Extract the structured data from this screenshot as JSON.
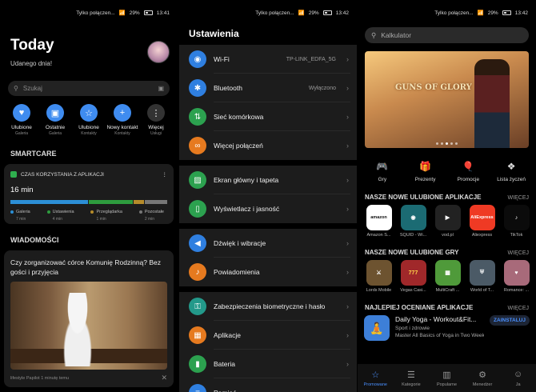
{
  "status": [
    {
      "carrier": "Tylko połączen...",
      "battery": "29%",
      "time": "13:41"
    },
    {
      "carrier": "Tylko połączen...",
      "battery": "29%",
      "time": "13:42"
    },
    {
      "carrier": "Tylko połączen...",
      "battery": "29%",
      "time": "13:42"
    }
  ],
  "today": {
    "title": "Today",
    "greeting": "Udanego dnia!",
    "search_placeholder": "Szukaj",
    "quick_actions": [
      {
        "label": "Ulubione",
        "sub": "Galeria",
        "icon": "heart-icon",
        "color": "#3f8cf0"
      },
      {
        "label": "Ostatnie",
        "sub": "Galeria",
        "icon": "image-icon",
        "color": "#3f8cf0"
      },
      {
        "label": "Ulubione",
        "sub": "Kontakty",
        "icon": "star-icon",
        "color": "#3f8cf0"
      },
      {
        "label": "Nowy kontakt",
        "sub": "Kontakty",
        "icon": "plus-icon",
        "color": "#3f8cf0"
      },
      {
        "label": "Więcej",
        "sub": "Usługi",
        "icon": "more-icon",
        "color": "#333"
      }
    ],
    "smartcare_title": "SMARTCARE",
    "usage_title": "CZAS KORZYSTANIA Z APLIKACJI",
    "usage_total": "16 min",
    "usage": [
      {
        "name": "Galeria",
        "value": "7 min",
        "minutes": 7,
        "color": "#2c8fd6"
      },
      {
        "name": "Ustawienia",
        "value": "4 min",
        "minutes": 4,
        "color": "#2e9c3e"
      },
      {
        "name": "Przeglądarka",
        "value": "1 min",
        "minutes": 1,
        "color": "#b58b2a"
      },
      {
        "name": "Pozostałe",
        "value": "2 min",
        "minutes": 2,
        "color": "#777"
      }
    ],
    "news_title": "WIADOMOŚCI",
    "news_headline": "Czy zorganizować córce Komunię Rodzinną? Bez gości i przyjęcia",
    "news_source": "lifestyle Papilot 1 minutę temu"
  },
  "settings": {
    "title": "Ustawienia",
    "groups": [
      [
        {
          "label": "Wi-Fi",
          "value": "TP-LINK_EDFA_5G",
          "icon": "wifi-icon",
          "color": "#2f7fe0"
        },
        {
          "label": "Bluetooth",
          "value": "Wyłączono",
          "icon": "bluetooth-icon",
          "color": "#2f7fe0"
        },
        {
          "label": "Sieć komórkowa",
          "value": "",
          "icon": "mobile-data-icon",
          "color": "#2ca14f"
        },
        {
          "label": "Więcej połączeń",
          "value": "",
          "icon": "link-icon",
          "color": "#e67a1f"
        }
      ],
      [
        {
          "label": "Ekran główny i tapeta",
          "value": "",
          "icon": "wallpaper-icon",
          "color": "#2ca14f"
        },
        {
          "label": "Wyświetlacz i jasność",
          "value": "",
          "icon": "display-icon",
          "color": "#2ca14f"
        }
      ],
      [
        {
          "label": "Dźwięk i wibracje",
          "value": "",
          "icon": "sound-icon",
          "color": "#2f7fe0"
        },
        {
          "label": "Powiadomienia",
          "value": "",
          "icon": "bell-icon",
          "color": "#e67a1f"
        }
      ],
      [
        {
          "label": "Zabezpieczenia biometryczne i hasło",
          "value": "",
          "icon": "key-icon",
          "color": "#23998a"
        },
        {
          "label": "Aplikacje",
          "value": "",
          "icon": "apps-icon",
          "color": "#e67a1f"
        },
        {
          "label": "Bateria",
          "value": "",
          "icon": "battery-icon",
          "color": "#2ca14f"
        },
        {
          "label": "Pamięć",
          "value": "",
          "icon": "storage-icon",
          "color": "#2f7fe0"
        }
      ]
    ]
  },
  "store": {
    "search_placeholder": "Kalkulator",
    "banner_title": "GUNS OF GLORY",
    "categories": [
      {
        "label": "Gry",
        "icon": "gamepad-icon"
      },
      {
        "label": "Prezenty",
        "icon": "gift-icon"
      },
      {
        "label": "Promocje",
        "icon": "balloon-icon"
      },
      {
        "label": "Lista życzeń",
        "icon": "wishlist-icon"
      }
    ],
    "sections": [
      {
        "title": "NASZE NOWE ULUBIONE APLIKACJE",
        "more": "WIĘCEJ",
        "apps": [
          {
            "name": "Amazon S...",
            "icon_text": "amazon",
            "bg": "#fff",
            "fg": "#111"
          },
          {
            "name": "SQUID - Wi...",
            "icon_text": "◉",
            "bg": "#1b6b73",
            "fg": "#fff"
          },
          {
            "name": "vod.pl",
            "icon_text": "▶",
            "bg": "#222",
            "fg": "#fff"
          },
          {
            "name": "Aliexpress",
            "icon_text": "AliExpress",
            "bg": "#ef3a24",
            "fg": "#fff"
          },
          {
            "name": "TikTok",
            "icon_text": "♪",
            "bg": "#0b0b0b",
            "fg": "#fff"
          }
        ]
      },
      {
        "title": "NASZE NOWE ULUBIONE GRY",
        "more": "WIĘCEJ",
        "apps": [
          {
            "name": "Lords Mobile",
            "icon_text": "⚔",
            "bg": "#6d5330",
            "fg": "#fff"
          },
          {
            "name": "Vegas Casi...",
            "icon_text": "777",
            "bg": "#a0282a",
            "fg": "#ffd24a"
          },
          {
            "name": "MultiCraft ...",
            "icon_text": "▦",
            "bg": "#4f9a3a",
            "fg": "#fff"
          },
          {
            "name": "World of T...",
            "icon_text": "⛨",
            "bg": "#4b5a66",
            "fg": "#fff"
          },
          {
            "name": "Romance: ...",
            "icon_text": "♥",
            "bg": "#a86a7a",
            "fg": "#fff"
          }
        ]
      },
      {
        "title": "NAJLEPIEJ OCENIANE APLIKACJE",
        "more": "WIĘCEJ",
        "apps": []
      }
    ],
    "featured": {
      "title": "Daily Yoga - Workout&Fit...",
      "subtitle": "Sport i zdrowie",
      "desc": "Master All Basics of Yoga in Two Weeks & Home",
      "button": "ZAINSTALUJ"
    },
    "nav": [
      {
        "label": "Promowane",
        "icon": "star-icon",
        "active": true
      },
      {
        "label": "Kategorie",
        "icon": "list-icon",
        "active": false
      },
      {
        "label": "Popularne",
        "icon": "chart-icon",
        "active": false
      },
      {
        "label": "Menedżer",
        "icon": "manager-icon",
        "active": false
      },
      {
        "label": "Ja",
        "icon": "person-icon",
        "active": false
      }
    ]
  }
}
